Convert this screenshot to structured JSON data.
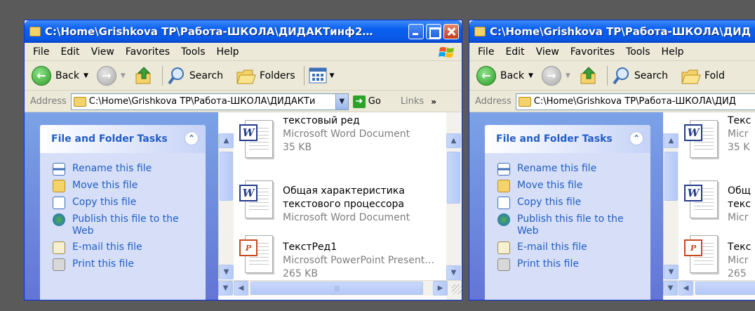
{
  "windows": [
    {
      "title": "C:\\Home\\Grishkova TP\\Работа-ШКОЛА\\ДИДАКТинф2…",
      "menu": [
        "File",
        "Edit",
        "View",
        "Favorites",
        "Tools",
        "Help"
      ],
      "toolbar": {
        "back": "Back",
        "search": "Search",
        "folders": "Folders"
      },
      "address": {
        "label": "Address",
        "value": "C:\\Home\\Grishkova TP\\Работа-ШКОЛА\\ДИДАКТи",
        "go": "Go",
        "links": "Links"
      },
      "tasks_title": "File and Folder Tasks",
      "tasks": [
        {
          "label": "Rename this file",
          "icon": "rename-icon"
        },
        {
          "label": "Move this file",
          "icon": "move-icon"
        },
        {
          "label": "Copy this file",
          "icon": "copy-icon"
        },
        {
          "label": "Publish this file to the Web",
          "icon": "publish-web-icon"
        },
        {
          "label": "E-mail this file",
          "icon": "email-icon"
        },
        {
          "label": "Print this file",
          "icon": "print-icon"
        }
      ],
      "files": [
        {
          "name": "текстовый ред",
          "type": "Microsoft Word Document",
          "size": "35 KB",
          "icon": "word-document-icon"
        },
        {
          "name": "Общая характеристика",
          "name2": "текстового процессора",
          "type": "Microsoft Word Document",
          "icon": "word-document-icon"
        },
        {
          "name": "ТекстРед1",
          "type": "Microsoft PowerPoint Present…",
          "size": "265 KB",
          "icon": "powerpoint-document-icon"
        }
      ]
    },
    {
      "title": "C:\\Home\\Grishkova TP\\Работа-ШКОЛА\\ДИД",
      "menu": [
        "File",
        "Edit",
        "View",
        "Favorites",
        "Tools",
        "Help"
      ],
      "toolbar": {
        "back": "Back",
        "search": "Search",
        "folders": "Fold"
      },
      "address": {
        "label": "Address",
        "value": "C:\\Home\\Grishkova TP\\Работа-ШКОЛА\\ДИД"
      },
      "tasks_title": "File and Folder Tasks",
      "tasks": [
        {
          "label": "Rename this file",
          "icon": "rename-icon"
        },
        {
          "label": "Move this file",
          "icon": "move-icon"
        },
        {
          "label": "Copy this file",
          "icon": "copy-icon"
        },
        {
          "label": "Publish this file to the Web",
          "icon": "publish-web-icon"
        },
        {
          "label": "E-mail this file",
          "icon": "email-icon"
        },
        {
          "label": "Print this file",
          "icon": "print-icon"
        }
      ],
      "files": [
        {
          "name": "Текс",
          "type": "Micr",
          "size": "35 K"
        },
        {
          "name": "Общ",
          "name2": "текс",
          "type": "Micr"
        },
        {
          "name": "Текс",
          "type": "Micr",
          "size": "265"
        }
      ]
    }
  ],
  "colors": {
    "titlebar": "#0a5ef0",
    "taskpane": "#7ba2e7",
    "task_link": "#215dc6",
    "background": "#5a5a5a"
  }
}
